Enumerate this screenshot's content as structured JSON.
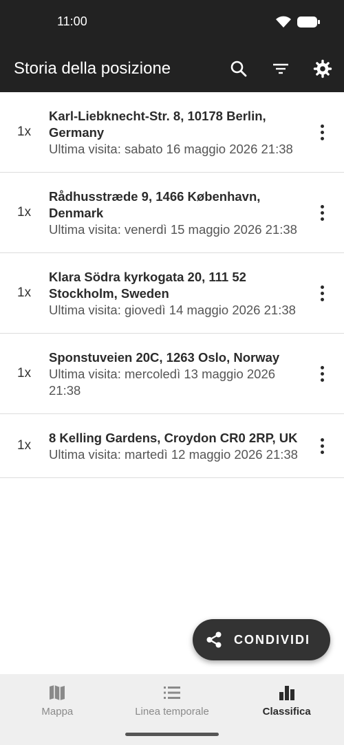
{
  "status_bar": {
    "time": "11:00",
    "icons": [
      "wifi-icon",
      "battery-icon"
    ]
  },
  "app_bar": {
    "title": "Storia della posizione",
    "actions": [
      "search-icon",
      "filter-icon",
      "gear-icon"
    ]
  },
  "locations": [
    {
      "count": "1x",
      "address": "Karl-Liebknecht-Str. 8, 10178 Berlin, Germany",
      "last_visit": "Ultima visita: sabato 16 maggio 2026 21:38"
    },
    {
      "count": "1x",
      "address": "Rådhusstræde 9, 1466 København, Denmark",
      "last_visit": "Ultima visita: venerdì 15 maggio 2026 21:38"
    },
    {
      "count": "1x",
      "address": "Klara Södra kyrkogata 20, 111 52 Stockholm, Sweden",
      "last_visit": "Ultima visita: giovedì 14 maggio 2026 21:38"
    },
    {
      "count": "1x",
      "address": "Sponstuveien 20C, 1263 Oslo, Norway",
      "last_visit": "Ultima visita: mercoledì 13 maggio 2026 21:38"
    },
    {
      "count": "1x",
      "address": "8 Kelling Gardens, Croydon CR0 2RP, UK",
      "last_visit": "Ultima visita: martedì 12 maggio 2026 21:38"
    }
  ],
  "fab": {
    "label": "CONDIVIDI",
    "icon": "share-icon"
  },
  "bottom_nav": [
    {
      "label": "Mappa",
      "icon": "map-icon",
      "active": false
    },
    {
      "label": "Linea temporale",
      "icon": "list-icon",
      "active": false
    },
    {
      "label": "Classifica",
      "icon": "bar-chart-icon",
      "active": true
    }
  ],
  "colors": {
    "app_bar": "#222222",
    "nav_bg": "#efefef",
    "fab": "#333333"
  }
}
